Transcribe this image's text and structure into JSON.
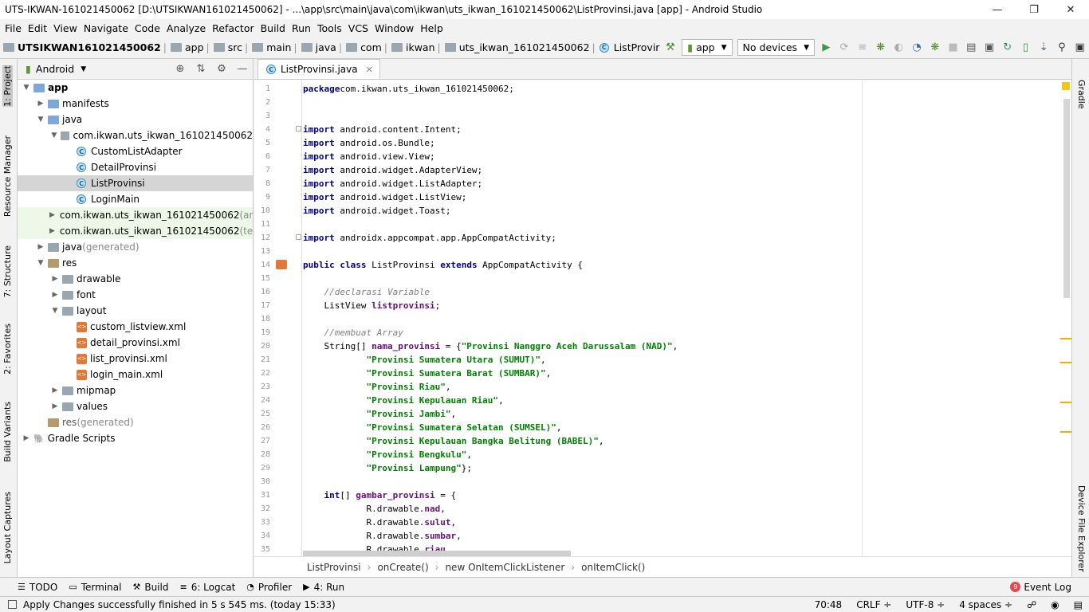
{
  "window": {
    "title": "UTS-IKWAN-161021450062 [D:\\UTSIKWAN161021450062] - ...\\app\\src\\main\\java\\com\\ikwan\\uts_ikwan_161021450062\\ListProvinsi.java [app] - Android Studio"
  },
  "menu": [
    "File",
    "Edit",
    "View",
    "Navigate",
    "Code",
    "Analyze",
    "Refactor",
    "Build",
    "Run",
    "Tools",
    "VCS",
    "Window",
    "Help"
  ],
  "breadcrumb": {
    "project": "UTSIKWAN161021450062",
    "items": [
      "app",
      "src",
      "main",
      "java",
      "com",
      "ikwan",
      "uts_ikwan_161021450062"
    ],
    "file": "ListProvir"
  },
  "toolbar": {
    "config": "app",
    "device": "No devices"
  },
  "left_tabs": [
    "1: Project",
    "Resource Manager",
    "7: Structure",
    "2: Favorites",
    "Build Variants",
    "Layout Captures"
  ],
  "right_tabs": [
    "Gradle",
    "Device File Explorer"
  ],
  "project": {
    "view": "Android",
    "tree": [
      {
        "label": "app",
        "indent": 0,
        "arrow": "▼",
        "icon": "folder-blue",
        "bold": true
      },
      {
        "label": "manifests",
        "indent": 1,
        "arrow": "▶",
        "icon": "folder-blue"
      },
      {
        "label": "java",
        "indent": 1,
        "arrow": "▼",
        "icon": "folder-blue"
      },
      {
        "label": "com.ikwan.uts_ikwan_161021450062",
        "indent": 2,
        "arrow": "▼",
        "icon": "folder-gray"
      },
      {
        "label": "CustomListAdapter",
        "indent": 3,
        "arrow": "",
        "icon": "class"
      },
      {
        "label": "DetailProvinsi",
        "indent": 3,
        "arrow": "",
        "icon": "class"
      },
      {
        "label": "ListProvinsi",
        "indent": 3,
        "arrow": "",
        "icon": "class",
        "selected": true
      },
      {
        "label": "LoginMain",
        "indent": 3,
        "arrow": "",
        "icon": "class"
      },
      {
        "label": "com.ikwan.uts_ikwan_161021450062",
        "suffix": " (andr",
        "indent": 2,
        "arrow": "▶",
        "icon": "folder-gray",
        "test": true
      },
      {
        "label": "com.ikwan.uts_ikwan_161021450062",
        "suffix": " (test)",
        "indent": 2,
        "arrow": "▶",
        "icon": "folder-gray",
        "test": true
      },
      {
        "label": "java",
        "suffix": " (generated)",
        "indent": 1,
        "arrow": "▶",
        "icon": "folder-gray"
      },
      {
        "label": "res",
        "indent": 1,
        "arrow": "▼",
        "icon": "folder-res"
      },
      {
        "label": "drawable",
        "indent": 2,
        "arrow": "▶",
        "icon": "folder-gray"
      },
      {
        "label": "font",
        "indent": 2,
        "arrow": "▶",
        "icon": "folder-gray"
      },
      {
        "label": "layout",
        "indent": 2,
        "arrow": "▼",
        "icon": "folder-gray"
      },
      {
        "label": "custom_listview.xml",
        "indent": 3,
        "arrow": "",
        "icon": "xml"
      },
      {
        "label": "detail_provinsi.xml",
        "indent": 3,
        "arrow": "",
        "icon": "xml"
      },
      {
        "label": "list_provinsi.xml",
        "indent": 3,
        "arrow": "",
        "icon": "xml"
      },
      {
        "label": "login_main.xml",
        "indent": 3,
        "arrow": "",
        "icon": "xml"
      },
      {
        "label": "mipmap",
        "indent": 2,
        "arrow": "▶",
        "icon": "folder-gray"
      },
      {
        "label": "values",
        "indent": 2,
        "arrow": "▶",
        "icon": "folder-gray"
      },
      {
        "label": "res",
        "suffix": " (generated)",
        "indent": 1,
        "arrow": "",
        "icon": "folder-res",
        "dim": true
      },
      {
        "label": "Gradle Scripts",
        "indent": 0,
        "arrow": "▶",
        "icon": "gradle"
      }
    ]
  },
  "editor": {
    "tab": "ListProvinsi.java",
    "lines": [
      [
        [
          "kw",
          "package"
        ],
        [
          "",
          "com.ikwan.uts_ikwan_161021450062;"
        ]
      ],
      [],
      [],
      [
        [
          "kw",
          "import"
        ],
        [
          "",
          " android.content.Intent;"
        ]
      ],
      [
        [
          "kw",
          "import"
        ],
        [
          "",
          " android.os.Bundle;"
        ]
      ],
      [
        [
          "kw",
          "import"
        ],
        [
          "",
          " android.view.View;"
        ]
      ],
      [
        [
          "kw",
          "import"
        ],
        [
          "",
          " android.widget.AdapterView;"
        ]
      ],
      [
        [
          "kw",
          "import"
        ],
        [
          "",
          " android.widget.ListAdapter;"
        ]
      ],
      [
        [
          "kw",
          "import"
        ],
        [
          "",
          " android.widget.ListView;"
        ]
      ],
      [
        [
          "kw",
          "import"
        ],
        [
          "",
          " android.widget.Toast;"
        ]
      ],
      [],
      [
        [
          "kw",
          "import"
        ],
        [
          "",
          " androidx.appcompat.app.AppCompatActivity;"
        ]
      ],
      [],
      [
        [
          "kw",
          "public class"
        ],
        [
          "",
          " ListProvinsi "
        ],
        [
          "kw",
          "extends"
        ],
        [
          "",
          " AppCompatActivity {"
        ]
      ],
      [],
      [
        [
          "cmt",
          "    //declarasi Variable"
        ]
      ],
      [
        [
          "",
          "    ListView "
        ],
        [
          "fld",
          "listprovinsi"
        ],
        [
          "",
          ";"
        ]
      ],
      [],
      [
        [
          "cmt",
          "    //membuat Array"
        ]
      ],
      [
        [
          "",
          "    String[] "
        ],
        [
          "fld",
          "nama_provinsi"
        ],
        [
          "",
          " = {"
        ],
        [
          "str",
          "\"Provinsi Nanggro Aceh Darussalam (NAD)\""
        ],
        [
          "",
          ","
        ]
      ],
      [
        [
          "",
          "            "
        ],
        [
          "str",
          "\"Provinsi Sumatera Utara (SUMUT)\""
        ],
        [
          "",
          ","
        ]
      ],
      [
        [
          "",
          "            "
        ],
        [
          "str",
          "\"Provinsi Sumatera Barat (SUMBAR)\""
        ],
        [
          "",
          ","
        ]
      ],
      [
        [
          "",
          "            "
        ],
        [
          "str",
          "\"Provinsi Riau\""
        ],
        [
          "",
          ","
        ]
      ],
      [
        [
          "",
          "            "
        ],
        [
          "str",
          "\"Provinsi Kepulauan Riau\""
        ],
        [
          "",
          ","
        ]
      ],
      [
        [
          "",
          "            "
        ],
        [
          "str",
          "\"Provinsi Jambi\""
        ],
        [
          "",
          ","
        ]
      ],
      [
        [
          "",
          "            "
        ],
        [
          "str",
          "\"Provinsi Sumatera Selatan (SUMSEL)\""
        ],
        [
          "",
          ","
        ]
      ],
      [
        [
          "",
          "            "
        ],
        [
          "str",
          "\"Provinsi Kepulauan Bangka Belitung (BABEL)\""
        ],
        [
          "",
          ","
        ]
      ],
      [
        [
          "",
          "            "
        ],
        [
          "str",
          "\"Provinsi Bengkulu\""
        ],
        [
          "",
          ","
        ]
      ],
      [
        [
          "",
          "            "
        ],
        [
          "str",
          "\"Provinsi Lampung\""
        ],
        [
          "",
          "};"
        ]
      ],
      [],
      [
        [
          "",
          "    "
        ],
        [
          "kw",
          "int"
        ],
        [
          "",
          "[] "
        ],
        [
          "fld",
          "gambar_provinsi"
        ],
        [
          "",
          " = {"
        ]
      ],
      [
        [
          "",
          "            R.drawable."
        ],
        [
          "fld",
          "nad"
        ],
        [
          "",
          ","
        ]
      ],
      [
        [
          "",
          "            R.drawable."
        ],
        [
          "fld",
          "sulut"
        ],
        [
          "",
          ","
        ]
      ],
      [
        [
          "",
          "            R.drawable."
        ],
        [
          "fld",
          "sumbar"
        ],
        [
          "",
          ","
        ]
      ],
      [
        [
          "",
          "            R.drawable."
        ],
        [
          "fld",
          "riau"
        ],
        [
          "",
          ","
        ]
      ]
    ]
  },
  "code_crumbs": [
    "ListProvinsi",
    "onCreate()",
    "new OnItemClickListener",
    "onItemClick()"
  ],
  "bottom_tabs": [
    {
      "icon": "☰",
      "label": "TODO"
    },
    {
      "icon": "▭",
      "label": "Terminal"
    },
    {
      "icon": "⚒",
      "label": "Build"
    },
    {
      "icon": "≡",
      "label": "6: Logcat"
    },
    {
      "icon": "◔",
      "label": "Profiler"
    },
    {
      "icon": "▶",
      "label": "4: Run"
    }
  ],
  "event_log": {
    "count": "9",
    "label": "Event Log"
  },
  "status": {
    "message": "Apply Changes successfully finished in 5 s 545 ms. (today 15:33)",
    "position": "70:48",
    "line_sep": "CRLF ÷",
    "encoding": "UTF-8 ÷",
    "indent": "4 spaces ÷"
  },
  "colors": {
    "keyword": "#000080",
    "string": "#008000",
    "comment": "#808080",
    "field": "#660e7a"
  }
}
